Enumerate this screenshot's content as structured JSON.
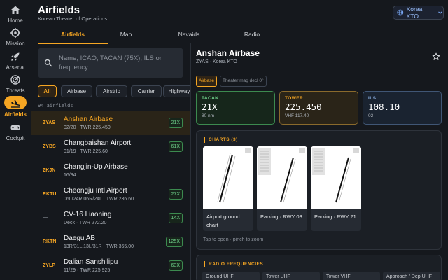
{
  "sidebar": {
    "items": [
      {
        "label": "Home",
        "icon": "home-icon"
      },
      {
        "label": "Mission",
        "icon": "crosshair-icon"
      },
      {
        "label": "Arsenal",
        "icon": "rocket-icon"
      },
      {
        "label": "Threats",
        "icon": "radar-icon"
      },
      {
        "label": "Airfields",
        "icon": "plane-landing-icon",
        "active": true
      },
      {
        "label": "Cockpit",
        "icon": "gamepad-icon"
      }
    ]
  },
  "header": {
    "title": "Airfields",
    "subtitle": "Korean Theater of Operations",
    "region_button": "Korea KTO"
  },
  "tabs": [
    {
      "label": "Airfields",
      "active": true
    },
    {
      "label": "Map"
    },
    {
      "label": "Navaids"
    },
    {
      "label": "Radio"
    }
  ],
  "search": {
    "placeholder": "Name, ICAO, TACAN (75X), ILS or frequency"
  },
  "filters": [
    "All",
    "Airbase",
    "Airstrip",
    "Carrier",
    "Highway"
  ],
  "count_label": "94 airfields",
  "airfields": [
    {
      "code": "ZYAS",
      "name": "Anshan Airbase",
      "meta": "02/20 · TWR 225.450",
      "tacan": "21X",
      "active": true
    },
    {
      "code": "ZYBS",
      "name": "Changbaishan Airport",
      "meta": "01/19 · TWR 225.60",
      "tacan": "61X"
    },
    {
      "code": "ZKJN",
      "name": "Changjin-Up Airbase",
      "meta": "16/34",
      "tacan": ""
    },
    {
      "code": "RKTU",
      "name": "Cheongju Intl Airport",
      "meta": "06L/24R 06R/24L · TWR 236.60",
      "tacan": "27X"
    },
    {
      "code": "—",
      "name": "CV-16 Liaoning",
      "meta": "Deck · TWR 272.20",
      "tacan": "14X"
    },
    {
      "code": "RKTN",
      "name": "Daegu AB",
      "meta": "13R/31L 13L/31R · TWR 365.00",
      "tacan": "125X"
    },
    {
      "code": "ZYLP",
      "name": "Dalian Sanshilipu",
      "meta": "11/29 · TWR 225.925",
      "tacan": "63X"
    }
  ],
  "detail": {
    "name": "Anshan Airbase",
    "subtitle": "ZYAS · Korea KTO",
    "type_tag": "Airbase",
    "mag_tag": "Theater mag decl 0°",
    "tacan": {
      "label": "TACAN",
      "value": "21X",
      "sub": "80 nm"
    },
    "tower": {
      "label": "TOWER",
      "value": "225.450",
      "sub": "VHF 117.40"
    },
    "ils": {
      "label": "ILS",
      "value": "108.10",
      "sub": "02"
    },
    "charts_header": "CHARTS (3)",
    "charts": [
      {
        "label": "Airport ground chart"
      },
      {
        "label": "Parking · RWY 03"
      },
      {
        "label": "Parking · RWY 21"
      }
    ],
    "charts_hint": "Tap to open · pinch to zoom",
    "radio_header": "RADIO FREQUENCIES",
    "radio": [
      "Ground UHF",
      "Tower UHF",
      "Tower VHF",
      "Approach / Dep UHF"
    ]
  },
  "colors": {
    "accent": "#f6a623",
    "tacan": "#6fd08a",
    "ils": "#8fb4e8",
    "background": "#15181d"
  }
}
